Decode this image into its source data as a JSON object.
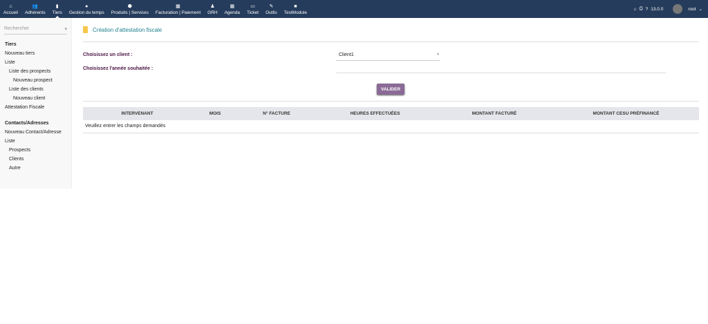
{
  "nav": [
    {
      "icon": "⌂",
      "label": "Accueil"
    },
    {
      "icon": "👥",
      "label": "Adhérents"
    },
    {
      "icon": "▮",
      "label": "Tiers",
      "active": true
    },
    {
      "icon": "●",
      "label": "Gestion du temps"
    },
    {
      "icon": "⬢",
      "label": "Produits | Services"
    },
    {
      "icon": "▦",
      "label": "Facturation | Paiement"
    },
    {
      "icon": "♟",
      "label": "GRH"
    },
    {
      "icon": "▦",
      "label": "Agenda"
    },
    {
      "icon": "▭",
      "label": "Ticket"
    },
    {
      "icon": "✎",
      "label": "Outils"
    },
    {
      "icon": "■",
      "label": "TestModule"
    }
  ],
  "topright": {
    "version": "13.0.0",
    "user": "root"
  },
  "sidebar": {
    "search_placeholder": "Rechercher",
    "items": [
      "Tiers",
      "Nouveau tiers",
      "Liste",
      "Liste des prospects",
      "Nouveau prospect",
      "Liste des clients",
      "Nouveau client",
      "Attestation Fiscale",
      "Contacts/Adresses",
      "Nouveau Contact/Adresse",
      "Liste",
      "Prospects",
      "Clients",
      "Autre"
    ]
  },
  "page": {
    "title": "Création d'attestation fiscale",
    "client_label": "Choisissez un client :",
    "client_value": "Client1",
    "year_label": "Choisissez l'année souhaitée :",
    "submit": "VALIDER"
  },
  "table": {
    "headers": [
      "INTERVENANT",
      "MOIS",
      "N° FACTURE",
      "HEURES EFFECTUÉES",
      "MONTANT FACTURÉ",
      "MONTANT CESU PRÉFINANCÉ"
    ],
    "empty": "Veuillez entrer les champs demandés"
  }
}
